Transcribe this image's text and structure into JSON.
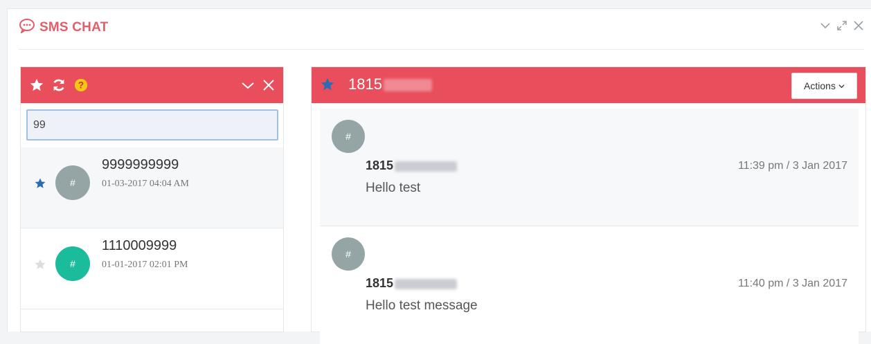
{
  "app": {
    "title": "SMS CHAT",
    "title_icon": "chat-bubble-icon",
    "accent": "#e84e5c",
    "title_color": "#e35d6a"
  },
  "window_controls": [
    "chevron-down-icon",
    "expand-icon",
    "close-icon"
  ],
  "left_panel": {
    "header_icons": [
      "star-icon",
      "refresh-icon",
      "help-icon"
    ],
    "header_controls": [
      "chevron-down-icon",
      "close-icon"
    ],
    "search": {
      "value": "99",
      "placeholder": ""
    },
    "contacts": [
      {
        "starred": true,
        "avatar": "#",
        "avatar_color": "#95a5a6",
        "name": "9999999999",
        "date": "01-03-2017 04:04 AM"
      },
      {
        "starred": false,
        "avatar": "#",
        "avatar_color": "#1abc9c",
        "name": "1110009999",
        "date": "01-01-2017 02:01 PM"
      }
    ]
  },
  "conversation": {
    "number": "1815",
    "number_redacted": true,
    "actions_label": "Actions",
    "messages": [
      {
        "avatar": "#",
        "sender": "1815",
        "time": "11:39 pm / 3 Jan 2017",
        "text": "Hello test"
      },
      {
        "avatar": "#",
        "sender": "1815",
        "time": "11:40 pm / 3 Jan 2017",
        "text": "Hello test message"
      }
    ]
  }
}
